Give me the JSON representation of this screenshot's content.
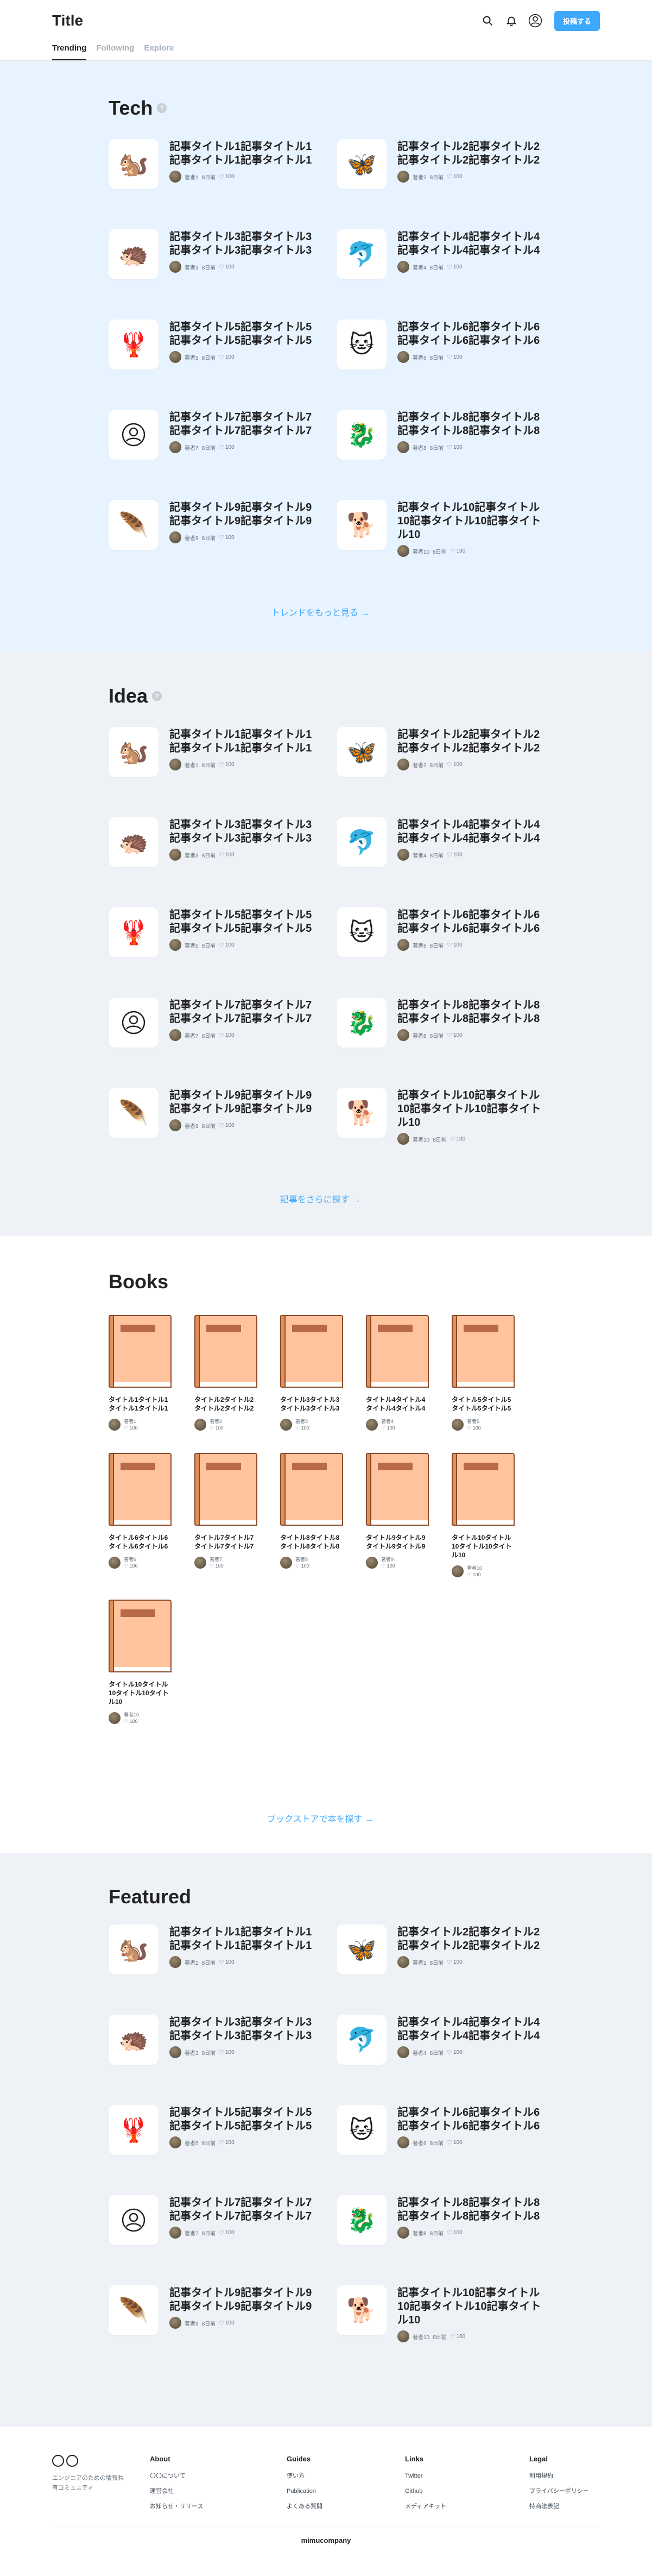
{
  "header": {
    "title": "Title",
    "post_button": "投稿する",
    "icons": [
      "search-icon",
      "bell-icon",
      "user-circle-icon"
    ]
  },
  "tabs": [
    {
      "label": "Trending",
      "active": true
    },
    {
      "label": "Following",
      "active": false
    },
    {
      "label": "Explore",
      "active": false
    }
  ],
  "colors": {
    "accent": "#3ea8ff",
    "section_bg_blue": "#e7f3ff",
    "section_bg_gray": "#eef2f7",
    "book_cover": "#ffc49e"
  },
  "tech": {
    "title": "Tech",
    "more_link": "トレンドをもっと見る →",
    "articles": [
      {
        "title": "記事タイトル1記事タイトル1記事タイトル1記事タイトル1",
        "author": "著者1",
        "date": "8日前",
        "likes": "100",
        "icon": "squirrel-icon",
        "emoji": "🐿️"
      },
      {
        "title": "記事タイトル2記事タイトル2記事タイトル2記事タイトル2",
        "author": "著者2",
        "date": "8日前",
        "likes": "100",
        "icon": "butterfly-icon",
        "emoji": "🦋"
      },
      {
        "title": "記事タイトル3記事タイトル3記事タイトル3記事タイトル3",
        "author": "著者3",
        "date": "8日前",
        "likes": "100",
        "icon": "armadillo-icon",
        "emoji": "🦔"
      },
      {
        "title": "記事タイトル4記事タイトル4記事タイトル4記事タイトル4",
        "author": "著者4",
        "date": "8日前",
        "likes": "100",
        "icon": "dolphin-icon",
        "emoji": "🐬"
      },
      {
        "title": "記事タイトル5記事タイトル5記事タイトル5記事タイトル5",
        "author": "著者5",
        "date": "8日前",
        "likes": "100",
        "icon": "lobster-icon",
        "emoji": "🦞"
      },
      {
        "title": "記事タイトル6記事タイトル6記事タイトル6記事タイトル6",
        "author": "著者6",
        "date": "8日前",
        "likes": "100",
        "icon": "cat-icon",
        "emoji": "🐱"
      },
      {
        "title": "記事タイトル7記事タイトル7記事タイトル7記事タイトル7",
        "author": "著者7",
        "date": "8日前",
        "likes": "100",
        "icon": "user-circle-icon",
        "emoji": ""
      },
      {
        "title": "記事タイトル8記事タイトル8記事タイトル8記事タイトル8",
        "author": "著者8",
        "date": "8日前",
        "likes": "100",
        "icon": "dragon-icon",
        "emoji": "🐉"
      },
      {
        "title": "記事タイトル9記事タイトル9記事タイトル9記事タイトル9",
        "author": "著者9",
        "date": "8日前",
        "likes": "100",
        "icon": "feather-icon",
        "emoji": "🪶"
      },
      {
        "title": "記事タイトル10記事タイトル10記事タイトル10記事タイトル10",
        "author": "著者10",
        "date": "8日前",
        "likes": "100",
        "icon": "dog-icon",
        "emoji": "🐕"
      }
    ]
  },
  "idea": {
    "title": "Idea",
    "more_link": "記事をさらに探す →",
    "articles": [
      {
        "title": "記事タイトル1記事タイトル1記事タイトル1記事タイトル1",
        "author": "著者1",
        "date": "8日前",
        "likes": "100",
        "icon": "squirrel-icon",
        "emoji": "🐿️"
      },
      {
        "title": "記事タイトル2記事タイトル2記事タイトル2記事タイトル2",
        "author": "著者2",
        "date": "8日前",
        "likes": "100",
        "icon": "butterfly-icon",
        "emoji": "🦋"
      },
      {
        "title": "記事タイトル3記事タイトル3記事タイトル3記事タイトル3",
        "author": "著者3",
        "date": "8日前",
        "likes": "100",
        "icon": "armadillo-icon",
        "emoji": "🦔"
      },
      {
        "title": "記事タイトル4記事タイトル4記事タイトル4記事タイトル4",
        "author": "著者4",
        "date": "8日前",
        "likes": "100",
        "icon": "dolphin-icon",
        "emoji": "🐬"
      },
      {
        "title": "記事タイトル5記事タイトル5記事タイトル5記事タイトル5",
        "author": "著者5",
        "date": "8日前",
        "likes": "100",
        "icon": "lobster-icon",
        "emoji": "🦞"
      },
      {
        "title": "記事タイトル6記事タイトル6記事タイトル6記事タイトル6",
        "author": "著者6",
        "date": "8日前",
        "likes": "100",
        "icon": "cat-icon",
        "emoji": "🐱"
      },
      {
        "title": "記事タイトル7記事タイトル7記事タイトル7記事タイトル7",
        "author": "著者7",
        "date": "8日前",
        "likes": "100",
        "icon": "user-circle-icon",
        "emoji": ""
      },
      {
        "title": "記事タイトル8記事タイトル8記事タイトル8記事タイトル8",
        "author": "著者8",
        "date": "8日前",
        "likes": "100",
        "icon": "dragon-icon",
        "emoji": "🐉"
      },
      {
        "title": "記事タイトル9記事タイトル9記事タイトル9記事タイトル9",
        "author": "著者9",
        "date": "8日前",
        "likes": "100",
        "icon": "feather-icon",
        "emoji": "🪶"
      },
      {
        "title": "記事タイトル10記事タイトル10記事タイトル10記事タイトル10",
        "author": "著者10",
        "date": "8日前",
        "likes": "100",
        "icon": "dog-icon",
        "emoji": "🐕"
      }
    ]
  },
  "books": {
    "title": "Books",
    "more_link": "ブックストアで本を探す →",
    "items": [
      {
        "title": "タイトル1タイトル1タイトル1タイトル1",
        "author": "著者1",
        "likes": "100"
      },
      {
        "title": "タイトル2タイトル2タイトル2タイトル2",
        "author": "著者2",
        "likes": "100"
      },
      {
        "title": "タイトル3タイトル3タイトル3タイトル3",
        "author": "著者3",
        "likes": "100"
      },
      {
        "title": "タイトル4タイトル4タイトル4タイトル4",
        "author": "著者4",
        "likes": "100"
      },
      {
        "title": "タイトル5タイトル5タイトル5タイトル5",
        "author": "著者5",
        "likes": "100"
      },
      {
        "title": "タイトル6タイトル6タイトル6タイトル6",
        "author": "著者6",
        "likes": "100"
      },
      {
        "title": "タイトル7タイトル7タイトル7タイトル7",
        "author": "著者7",
        "likes": "100"
      },
      {
        "title": "タイトル8タイトル8タイトル8タイトル8",
        "author": "著者8",
        "likes": "100"
      },
      {
        "title": "タイトル9タイトル9タイトル9タイトル9",
        "author": "著者9",
        "likes": "100"
      },
      {
        "title": "タイトル10タイトル10タイトル10タイトル10",
        "author": "著者10",
        "likes": "100"
      },
      {
        "title": "タイトル10タイトル10タイトル10タイトル10",
        "author": "著者10",
        "likes": "100"
      }
    ]
  },
  "featured": {
    "title": "Featured",
    "articles": [
      {
        "title": "記事タイトル1記事タイトル1記事タイトル1記事タイトル1",
        "author": "著者1",
        "date": "8日前",
        "likes": "100",
        "icon": "squirrel-icon",
        "emoji": "🐿️"
      },
      {
        "title": "記事タイトル2記事タイトル2記事タイトル2記事タイトル2",
        "author": "著者2",
        "date": "8日前",
        "likes": "100",
        "icon": "butterfly-icon",
        "emoji": "🦋"
      },
      {
        "title": "記事タイトル3記事タイトル3記事タイトル3記事タイトル3",
        "author": "著者3",
        "date": "8日前",
        "likes": "100",
        "icon": "armadillo-icon",
        "emoji": "🦔"
      },
      {
        "title": "記事タイトル4記事タイトル4記事タイトル4記事タイトル4",
        "author": "著者4",
        "date": "8日前",
        "likes": "100",
        "icon": "dolphin-icon",
        "emoji": "🐬"
      },
      {
        "title": "記事タイトル5記事タイトル5記事タイトル5記事タイトル5",
        "author": "著者5",
        "date": "8日前",
        "likes": "100",
        "icon": "lobster-icon",
        "emoji": "🦞"
      },
      {
        "title": "記事タイトル6記事タイトル6記事タイトル6記事タイトル6",
        "author": "著者6",
        "date": "8日前",
        "likes": "100",
        "icon": "cat-icon",
        "emoji": "🐱"
      },
      {
        "title": "記事タイトル7記事タイトル7記事タイトル7記事タイトル7",
        "author": "著者7",
        "date": "8日前",
        "likes": "100",
        "icon": "user-circle-icon",
        "emoji": ""
      },
      {
        "title": "記事タイトル8記事タイトル8記事タイトル8記事タイトル8",
        "author": "著者8",
        "date": "8日前",
        "likes": "100",
        "icon": "dragon-icon",
        "emoji": "🐉"
      },
      {
        "title": "記事タイトル9記事タイトル9記事タイトル9記事タイトル9",
        "author": "著者9",
        "date": "8日前",
        "likes": "100",
        "icon": "feather-icon",
        "emoji": "🪶"
      },
      {
        "title": "記事タイトル10記事タイトル10記事タイトル10記事タイトル10",
        "author": "著者10",
        "date": "8日前",
        "likes": "100",
        "icon": "dog-icon",
        "emoji": "🐕"
      }
    ]
  },
  "footer": {
    "tagline": "エンジニアのための情報共有コミュニティ",
    "columns": [
      {
        "heading": "About",
        "links": [
          "〇〇について",
          "運営会社",
          "お知らせ・リリース"
        ]
      },
      {
        "heading": "Guides",
        "links": [
          "使い方",
          "Publication",
          "よくある質問"
        ]
      },
      {
        "heading": "Links",
        "links": [
          "Twitter",
          "Github",
          "メディアキット"
        ]
      },
      {
        "heading": "Legal",
        "links": [
          "利用規約",
          "プライバシーポリシー",
          "特商法表記"
        ]
      }
    ],
    "company": "mimucompany"
  }
}
